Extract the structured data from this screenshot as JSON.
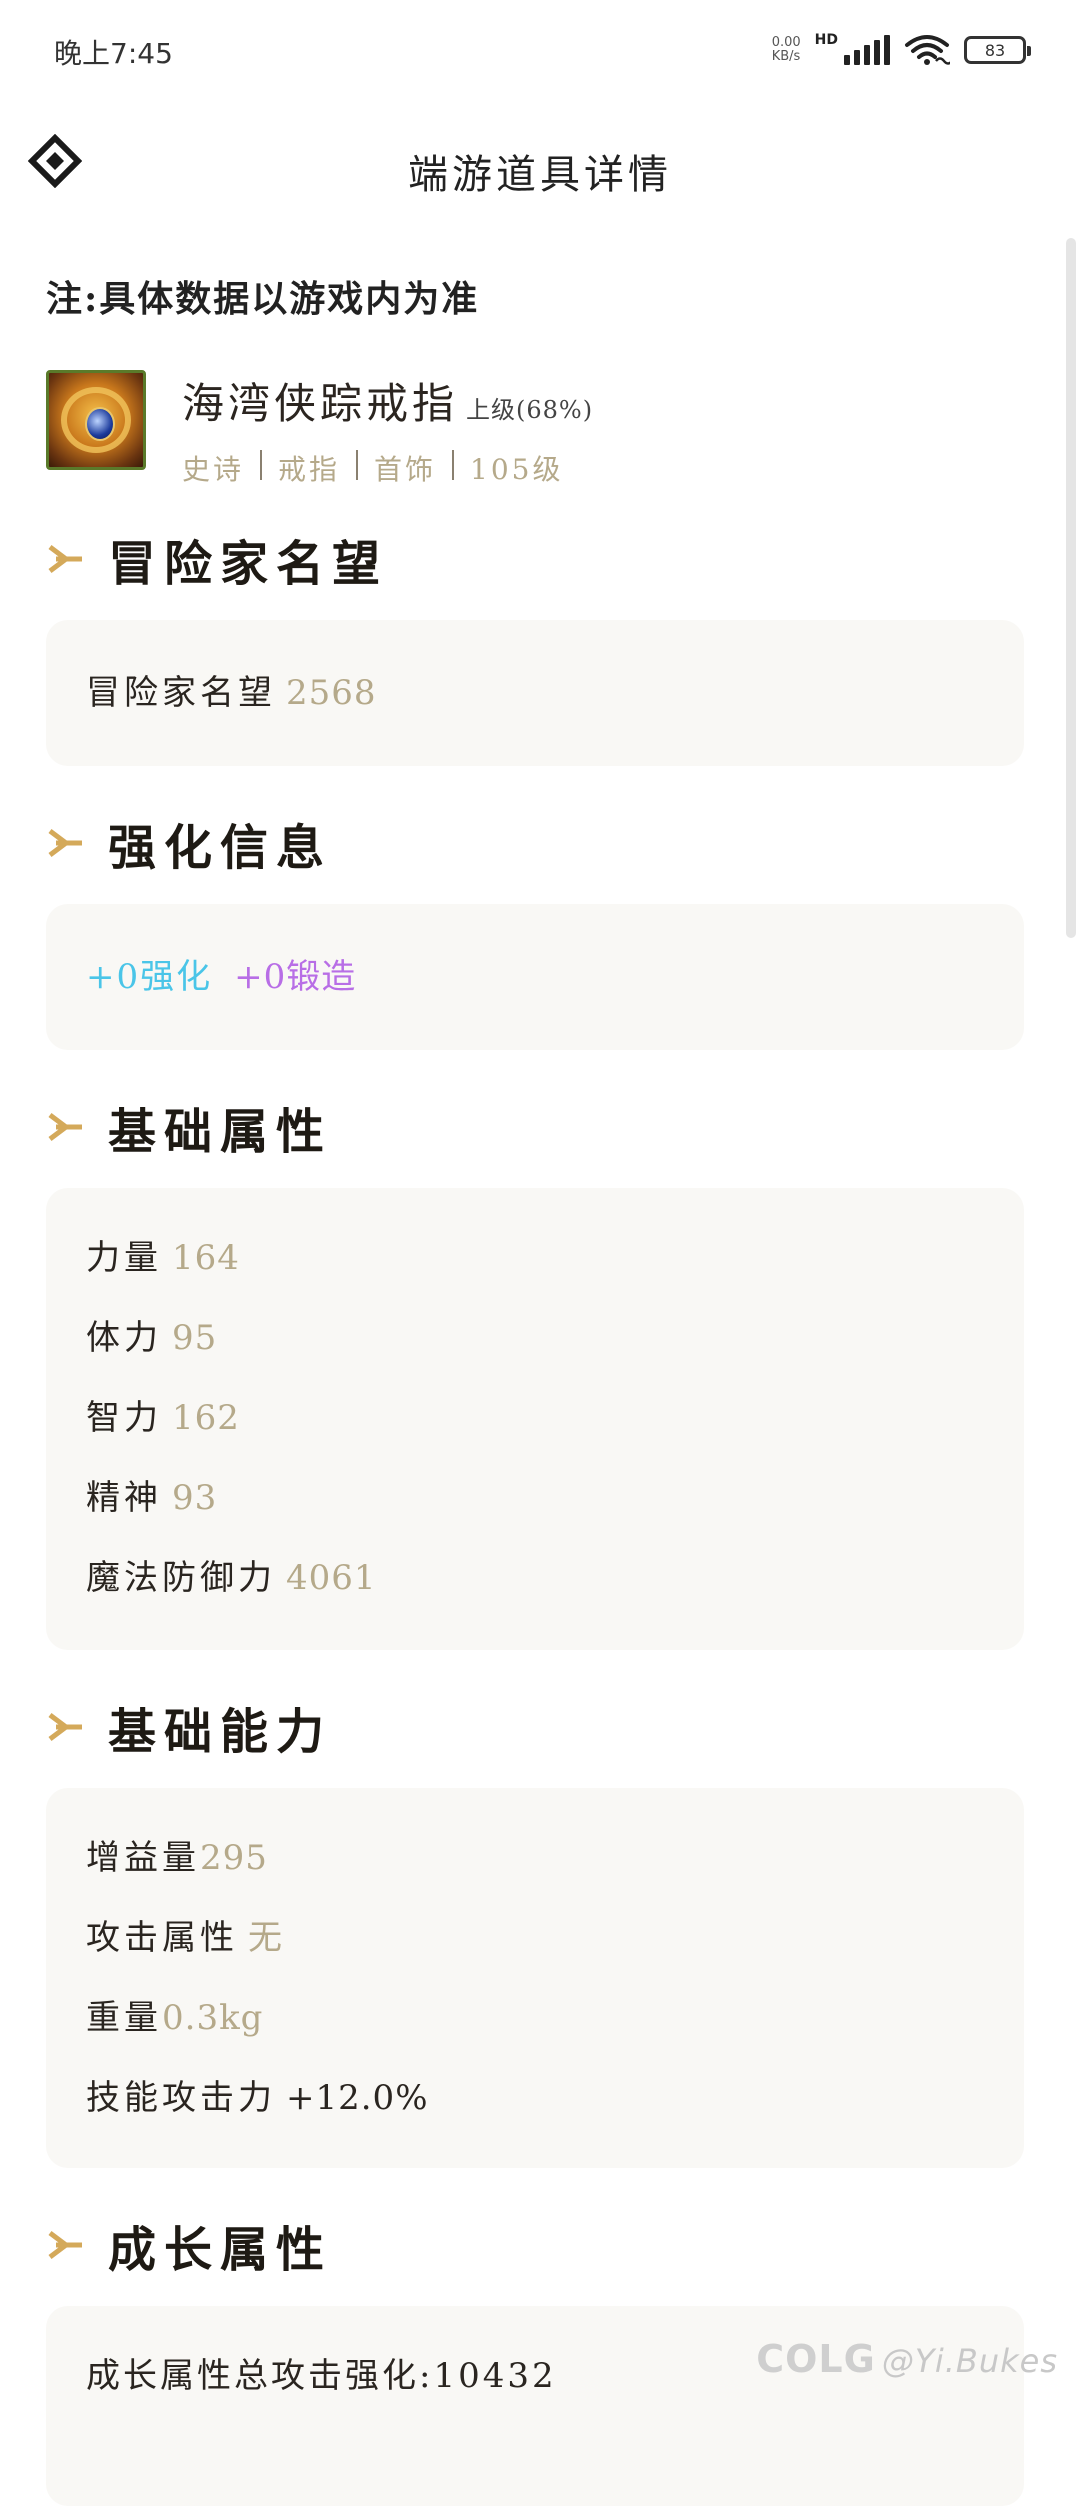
{
  "status_bar": {
    "time": "晚上7:45",
    "net_speed_top": "0.00",
    "net_speed_bottom": "KB/s",
    "hd": "HD",
    "battery": "83"
  },
  "header": {
    "title": "端游道具详情"
  },
  "note": "注:具体数据以游戏内为准",
  "item": {
    "name": "海湾侠踪戒指",
    "grade": "上级(68%)",
    "tags": [
      "史诗",
      "戒指",
      "首饰",
      "105级"
    ]
  },
  "sections": {
    "reputation": {
      "title": "冒险家名望",
      "label": "冒险家名望",
      "value": "2568"
    },
    "enhance": {
      "title": "强化信息",
      "enhance_text": "+0强化",
      "forge_text": "+0锻造"
    },
    "base_attrs": {
      "title": "基础属性",
      "rows": [
        {
          "label": "力量",
          "value": "164"
        },
        {
          "label": "体力",
          "value": "95"
        },
        {
          "label": "智力",
          "value": "162"
        },
        {
          "label": "精神",
          "value": "93"
        },
        {
          "label": "魔法防御力",
          "value": "4061"
        }
      ]
    },
    "base_abilities": {
      "title": "基础能力",
      "rows": [
        {
          "label": "增益量",
          "value": "295"
        },
        {
          "label": "攻击属性",
          "value": "无"
        },
        {
          "label": "重量",
          "value": "0.3kg"
        },
        {
          "label": "技能攻击力",
          "value": "+12.0%"
        }
      ]
    },
    "growth": {
      "title": "成长属性",
      "first_row": "成长属性总攻击强化:10432"
    }
  },
  "watermark": {
    "brand": "COLG",
    "user": "@Yi.Bukes"
  },
  "colors": {
    "accent_arrow": "#d4a95a",
    "value_muted": "#b5a98a",
    "enhance": "#4ac5e8",
    "forge": "#b86ee6",
    "card_bg": "#f9f8f5"
  }
}
